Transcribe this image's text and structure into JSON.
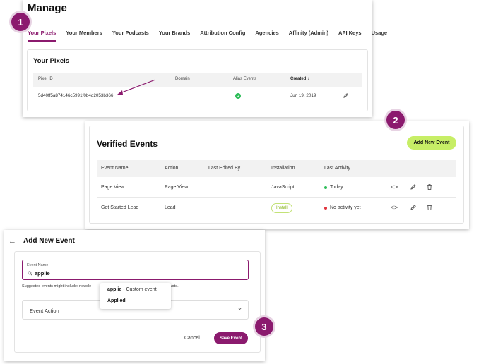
{
  "colors": {
    "brand": "#8b1a6e",
    "accent_green": "#c7ee66",
    "status_green": "#2ebd59",
    "status_red": "#e0323c"
  },
  "steps": [
    "1",
    "2",
    "3"
  ],
  "manage": {
    "title": "Manage",
    "tabs": [
      {
        "label": "Your Pixels",
        "active": true
      },
      {
        "label": "Your Members"
      },
      {
        "label": "Your Podcasts"
      },
      {
        "label": "Your Brands"
      },
      {
        "label": "Attribution Config"
      },
      {
        "label": "Agencies"
      },
      {
        "label": "Affinity (Admin)"
      },
      {
        "label": "API Keys"
      },
      {
        "label": "Usage"
      }
    ],
    "card_title": "Your Pixels",
    "columns": [
      "Pixel ID",
      "Domain",
      "Alias Events",
      "Created ↓"
    ],
    "row": {
      "pixel_id": "5d40ff5a874146c5991f0b4d2053b366",
      "domain": "",
      "alias_icon": "check-circle-icon",
      "created": "Jun 19, 2019",
      "action_icon": "pencil-icon"
    }
  },
  "verified": {
    "title": "Verified Events",
    "add_button": "Add New Event",
    "columns": [
      "Event Name",
      "Action",
      "Last Edited By",
      "Installation",
      "Last Activity"
    ],
    "rows": [
      {
        "event_name": "Page View",
        "action": "Page View",
        "last_edited_by": "",
        "installation": "JavaScript",
        "last_activity": "Today",
        "status": "green"
      },
      {
        "event_name": "Get Started Lead",
        "action": "Lead",
        "last_edited_by": "",
        "installation": "Install",
        "last_activity": "No activity yet",
        "status": "red"
      }
    ],
    "row_icons": [
      "code-icon",
      "pencil-icon",
      "trash-icon"
    ]
  },
  "new_event": {
    "back_icon": "arrow-left-icon",
    "title": "Add New Event",
    "field_label": "Event Name",
    "field_value": "applie",
    "hint": "Suggested events might include: newsle",
    "hint_tail": "or quote.",
    "suggestions": [
      {
        "name": "applie",
        "suffix": " - Custom event"
      },
      {
        "name": "Applied",
        "suffix": ""
      }
    ],
    "select_label": "Event Action",
    "cancel": "Cancel",
    "save": "Save Event"
  }
}
